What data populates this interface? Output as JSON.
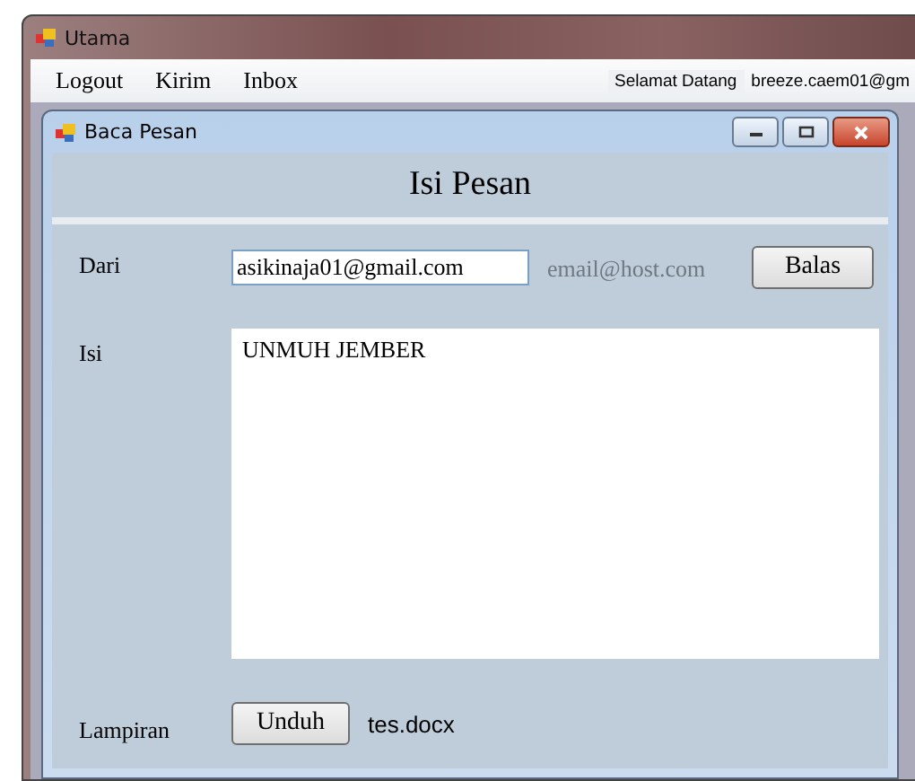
{
  "window": {
    "title": "Utama"
  },
  "menu": [
    "Logout",
    "Kirim",
    "Inbox"
  ],
  "greeting": {
    "label": "Selamat Datang",
    "user": "breeze.caem01@gm"
  },
  "child_window": {
    "title": "Baca Pesan"
  },
  "header": "Isi Pesan",
  "form": {
    "from_label": "Dari",
    "from_value": "asikinaja01@gmail.com",
    "hint": "email@host.com",
    "reply_button": "Balas",
    "body_label": "Isi",
    "body_value": "UNMUH JEMBER",
    "attachment_label": "Lampiran",
    "download_button": "Unduh",
    "attachment_name": "tes.docx"
  }
}
